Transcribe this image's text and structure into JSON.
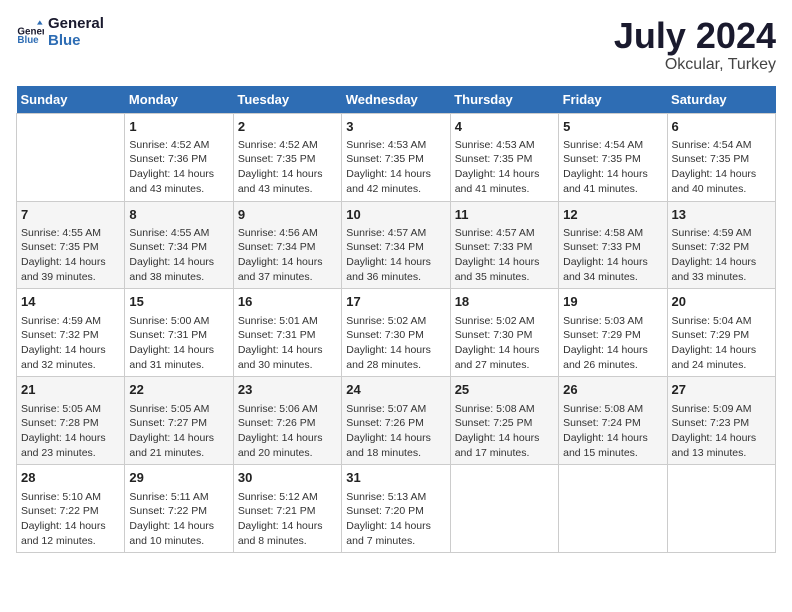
{
  "logo": {
    "text_general": "General",
    "text_blue": "Blue"
  },
  "title": "July 2024",
  "subtitle": "Okcular, Turkey",
  "days_header": [
    "Sunday",
    "Monday",
    "Tuesday",
    "Wednesday",
    "Thursday",
    "Friday",
    "Saturday"
  ],
  "weeks": [
    [
      {
        "day": "",
        "info": ""
      },
      {
        "day": "1",
        "info": "Sunrise: 4:52 AM\nSunset: 7:36 PM\nDaylight: 14 hours\nand 43 minutes."
      },
      {
        "day": "2",
        "info": "Sunrise: 4:52 AM\nSunset: 7:35 PM\nDaylight: 14 hours\nand 43 minutes."
      },
      {
        "day": "3",
        "info": "Sunrise: 4:53 AM\nSunset: 7:35 PM\nDaylight: 14 hours\nand 42 minutes."
      },
      {
        "day": "4",
        "info": "Sunrise: 4:53 AM\nSunset: 7:35 PM\nDaylight: 14 hours\nand 41 minutes."
      },
      {
        "day": "5",
        "info": "Sunrise: 4:54 AM\nSunset: 7:35 PM\nDaylight: 14 hours\nand 41 minutes."
      },
      {
        "day": "6",
        "info": "Sunrise: 4:54 AM\nSunset: 7:35 PM\nDaylight: 14 hours\nand 40 minutes."
      }
    ],
    [
      {
        "day": "7",
        "info": "Sunrise: 4:55 AM\nSunset: 7:35 PM\nDaylight: 14 hours\nand 39 minutes."
      },
      {
        "day": "8",
        "info": "Sunrise: 4:55 AM\nSunset: 7:34 PM\nDaylight: 14 hours\nand 38 minutes."
      },
      {
        "day": "9",
        "info": "Sunrise: 4:56 AM\nSunset: 7:34 PM\nDaylight: 14 hours\nand 37 minutes."
      },
      {
        "day": "10",
        "info": "Sunrise: 4:57 AM\nSunset: 7:34 PM\nDaylight: 14 hours\nand 36 minutes."
      },
      {
        "day": "11",
        "info": "Sunrise: 4:57 AM\nSunset: 7:33 PM\nDaylight: 14 hours\nand 35 minutes."
      },
      {
        "day": "12",
        "info": "Sunrise: 4:58 AM\nSunset: 7:33 PM\nDaylight: 14 hours\nand 34 minutes."
      },
      {
        "day": "13",
        "info": "Sunrise: 4:59 AM\nSunset: 7:32 PM\nDaylight: 14 hours\nand 33 minutes."
      }
    ],
    [
      {
        "day": "14",
        "info": "Sunrise: 4:59 AM\nSunset: 7:32 PM\nDaylight: 14 hours\nand 32 minutes."
      },
      {
        "day": "15",
        "info": "Sunrise: 5:00 AM\nSunset: 7:31 PM\nDaylight: 14 hours\nand 31 minutes."
      },
      {
        "day": "16",
        "info": "Sunrise: 5:01 AM\nSunset: 7:31 PM\nDaylight: 14 hours\nand 30 minutes."
      },
      {
        "day": "17",
        "info": "Sunrise: 5:02 AM\nSunset: 7:30 PM\nDaylight: 14 hours\nand 28 minutes."
      },
      {
        "day": "18",
        "info": "Sunrise: 5:02 AM\nSunset: 7:30 PM\nDaylight: 14 hours\nand 27 minutes."
      },
      {
        "day": "19",
        "info": "Sunrise: 5:03 AM\nSunset: 7:29 PM\nDaylight: 14 hours\nand 26 minutes."
      },
      {
        "day": "20",
        "info": "Sunrise: 5:04 AM\nSunset: 7:29 PM\nDaylight: 14 hours\nand 24 minutes."
      }
    ],
    [
      {
        "day": "21",
        "info": "Sunrise: 5:05 AM\nSunset: 7:28 PM\nDaylight: 14 hours\nand 23 minutes."
      },
      {
        "day": "22",
        "info": "Sunrise: 5:05 AM\nSunset: 7:27 PM\nDaylight: 14 hours\nand 21 minutes."
      },
      {
        "day": "23",
        "info": "Sunrise: 5:06 AM\nSunset: 7:26 PM\nDaylight: 14 hours\nand 20 minutes."
      },
      {
        "day": "24",
        "info": "Sunrise: 5:07 AM\nSunset: 7:26 PM\nDaylight: 14 hours\nand 18 minutes."
      },
      {
        "day": "25",
        "info": "Sunrise: 5:08 AM\nSunset: 7:25 PM\nDaylight: 14 hours\nand 17 minutes."
      },
      {
        "day": "26",
        "info": "Sunrise: 5:08 AM\nSunset: 7:24 PM\nDaylight: 14 hours\nand 15 minutes."
      },
      {
        "day": "27",
        "info": "Sunrise: 5:09 AM\nSunset: 7:23 PM\nDaylight: 14 hours\nand 13 minutes."
      }
    ],
    [
      {
        "day": "28",
        "info": "Sunrise: 5:10 AM\nSunset: 7:22 PM\nDaylight: 14 hours\nand 12 minutes."
      },
      {
        "day": "29",
        "info": "Sunrise: 5:11 AM\nSunset: 7:22 PM\nDaylight: 14 hours\nand 10 minutes."
      },
      {
        "day": "30",
        "info": "Sunrise: 5:12 AM\nSunset: 7:21 PM\nDaylight: 14 hours\nand 8 minutes."
      },
      {
        "day": "31",
        "info": "Sunrise: 5:13 AM\nSunset: 7:20 PM\nDaylight: 14 hours\nand 7 minutes."
      },
      {
        "day": "",
        "info": ""
      },
      {
        "day": "",
        "info": ""
      },
      {
        "day": "",
        "info": ""
      }
    ]
  ]
}
